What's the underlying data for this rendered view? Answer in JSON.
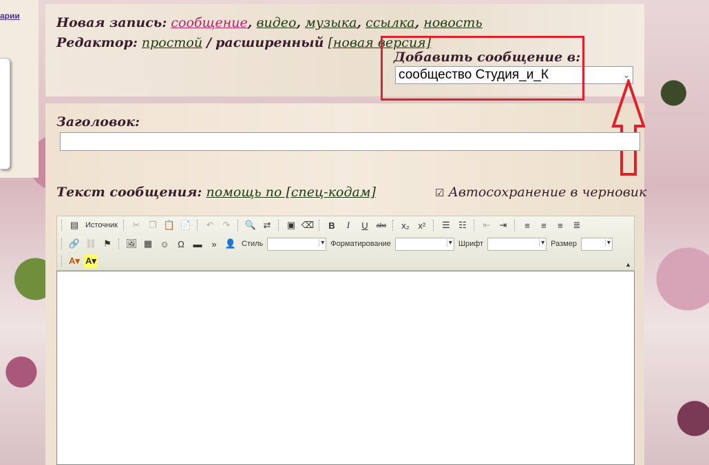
{
  "left_panel": {
    "link": "арии"
  },
  "new_post": {
    "label": "Новая запись:",
    "types": [
      "сообщение",
      "видео",
      "музыка",
      "ссылка",
      "новость"
    ],
    "separator": ","
  },
  "editor_mode": {
    "label": "Редактор:",
    "simple": "простой",
    "slash": "/",
    "extended": "расширенный",
    "new_version": "[новая версия]"
  },
  "destination": {
    "label": "Добавить сообщение в:",
    "selected": "сообщество Студия_и_К"
  },
  "title_field": {
    "label": "Заголовок:",
    "value": ""
  },
  "message": {
    "label": "Текст сообщения:",
    "help_link": "помощь по [спец-кодам]",
    "autosave_label": "Автосохранение в черновик",
    "autosave_checked": true
  },
  "toolbar": {
    "source_label": "Источник",
    "style_label": "Стиль",
    "format_label": "Форматирование",
    "font_label": "Шрифт",
    "size_label": "Размер"
  },
  "colors": {
    "highlight": "#e0202a",
    "link": "#1d3a0e",
    "link_active": "#b0246c"
  }
}
